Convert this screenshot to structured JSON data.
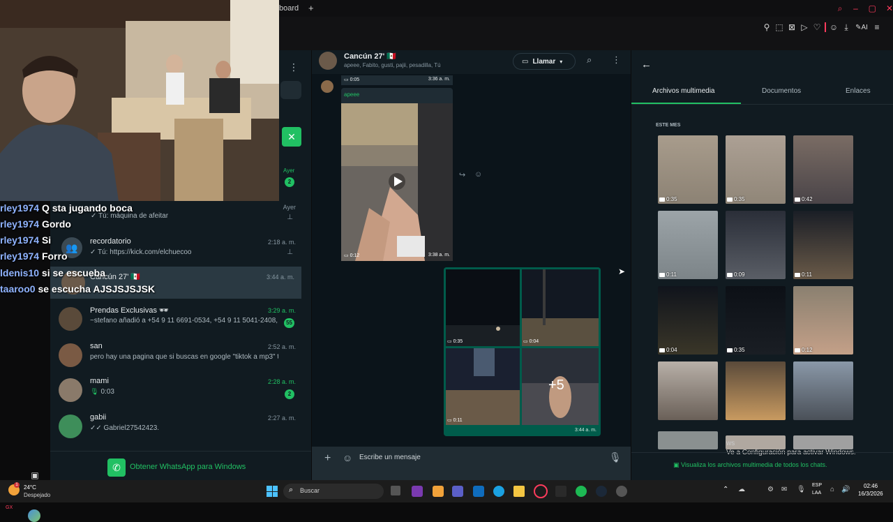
{
  "browser": {
    "tab_text": "board",
    "ai_label": "AI"
  },
  "stream_chat": [
    {
      "user": "rley1974",
      "msg": "Q sta jugando boca"
    },
    {
      "user": "rley1974",
      "msg": "Gordo"
    },
    {
      "user": "rley1974",
      "msg": "Si"
    },
    {
      "user": "rley1974",
      "msg": "Forro"
    },
    {
      "user": "ldenis10",
      "msg": "si se escueba"
    },
    {
      "user": "taaroo0",
      "msg": "se escucha AJSJSJSJSK"
    }
  ],
  "chatlist": {
    "items": [
      {
        "name": "",
        "preview": "Tú: máquina de afeitar",
        "time": "Ayer"
      },
      {
        "name": "recordatorio",
        "preview": "Tú: https://kick.com/elchuecoo",
        "time": "2:18 a. m."
      },
      {
        "name": "Cancún 27' 🇲🇽",
        "preview": "",
        "time": "3:44 a. m."
      },
      {
        "name": "Prendas Exclusivas 🕶",
        "preview": "~stefano añadió a +54 9 11 6691-0534, +54 9 11 5041-2408, ...",
        "time": "3:29 a. m.",
        "unread": "55"
      },
      {
        "name": "san",
        "preview": "pero hay una pagina que si buscas en google \"tiktok a mp3\" te salta",
        "time": "2:52 a. m."
      },
      {
        "name": "mami",
        "preview": "0:03",
        "time": "2:28 a. m.",
        "unread": "2"
      },
      {
        "name": "gabii",
        "preview": "Gabriel27542423.",
        "time": "2:27 a. m."
      }
    ],
    "ayer_top": "Ayer",
    "ayer_unread": "2",
    "get_whatsapp": "Obtener WhatsApp para Windows"
  },
  "conversation": {
    "title": "Cancún 27' 🇲🇽",
    "members": "apeee, Fabito, gusti, pajii, pesadilla, Tú",
    "call_label": "Llamar",
    "top_msg_duration": "0:05",
    "top_msg_time": "3:36 a. m.",
    "sender": "apeee",
    "video_duration": "0:12",
    "video_time": "3:38 a. m.",
    "grid": [
      {
        "duration": "0:35"
      },
      {
        "duration": "0:04"
      },
      {
        "duration": "0:11"
      },
      {
        "duration": ""
      }
    ],
    "more_count": "+5",
    "grid_time": "3:44 a. m.",
    "composer_placeholder": "Escribe un mensaje"
  },
  "media_panel": {
    "tabs": [
      "Archivos multimedia",
      "Documentos",
      "Enlaces"
    ],
    "section": "ESTE MES",
    "thumbs": [
      {
        "duration": "0:35"
      },
      {
        "duration": "0:35"
      },
      {
        "duration": "0:42"
      },
      {
        "duration": "0:11"
      },
      {
        "duration": "0:09"
      },
      {
        "duration": "0:11"
      },
      {
        "duration": "0:04"
      },
      {
        "duration": "0:35"
      },
      {
        "duration": "0:12"
      },
      {
        "duration": ""
      },
      {
        "duration": ""
      },
      {
        "duration": ""
      }
    ],
    "footer": "Visualiza los archivos multimedia de todos los chats.",
    "activate_line1": "Ve a Configuración para activar Windows.",
    "activate_prefix": "ws"
  },
  "taskbar": {
    "weather_temp": "24°C",
    "weather_desc": "Despejado",
    "search": "Buscar",
    "lang1": "ESP",
    "lang2": "LAA",
    "time": "02:46",
    "date": "16/3/2026"
  },
  "colors": {
    "accent": "#21c063",
    "gx": "#ff3b5c"
  }
}
